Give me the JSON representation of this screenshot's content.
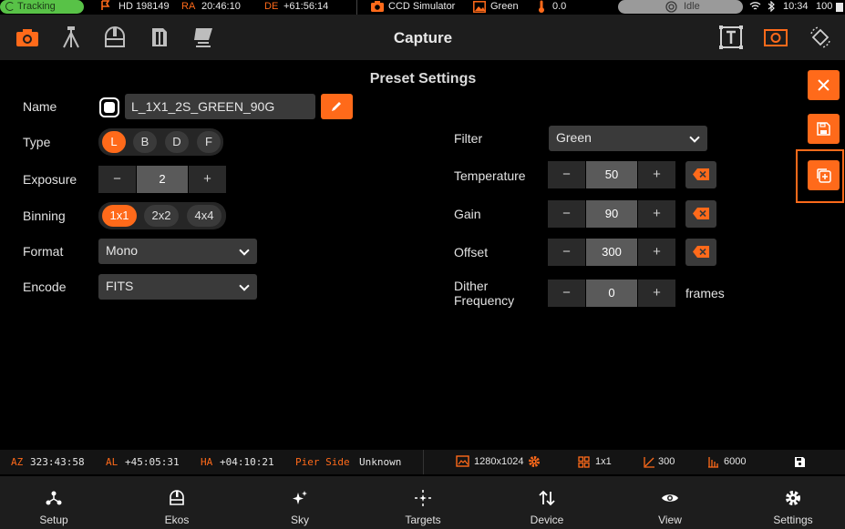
{
  "status_bar": {
    "tracking_label": "Tracking",
    "target": "HD 198149",
    "ra_label": "RA",
    "ra_value": "20:46:10",
    "de_label": "DE",
    "de_value": "+61:56:14",
    "camera": "CCD Simulator",
    "filter": "Green",
    "temperature": "0.0",
    "state": "Idle",
    "time": "10:34",
    "battery": "100"
  },
  "toolbar": {
    "title": "Capture"
  },
  "preset": {
    "section_title": "Preset Settings",
    "name_label": "Name",
    "name_value": "L_1X1_2S_GREEN_90G",
    "type_label": "Type",
    "type_options": [
      "L",
      "B",
      "D",
      "F"
    ],
    "type_selected": "L",
    "exposure_label": "Exposure",
    "exposure_value": "2",
    "binning_label": "Binning",
    "binning_options": [
      "1x1",
      "2x2",
      "4x4"
    ],
    "binning_selected": "1x1",
    "format_label": "Format",
    "format_value": "Mono",
    "encode_label": "Encode",
    "encode_value": "FITS",
    "filter_label": "Filter",
    "filter_value": "Green",
    "temperature_label": "Temperature",
    "temperature_value": "50",
    "gain_label": "Gain",
    "gain_value": "90",
    "offset_label": "Offset",
    "offset_value": "300",
    "dither_label_line1": "Dither",
    "dither_label_line2": "Frequency",
    "dither_value": "0",
    "dither_unit": "frames",
    "minus": "−",
    "plus": "+"
  },
  "info_bar": {
    "az_label": "AZ",
    "az_value": "323:43:58",
    "al_label": "AL",
    "al_value": "+45:05:31",
    "ha_label": "HA",
    "ha_value": "+04:10:21",
    "pier_label": "Pier Side",
    "pier_value": "Unknown",
    "resolution": "1280x1024",
    "binning": "1x1",
    "gain": "300",
    "offset": "6000"
  },
  "bottom_nav": [
    {
      "label": "Setup",
      "icon": "setup-icon"
    },
    {
      "label": "Ekos",
      "icon": "ekos-icon"
    },
    {
      "label": "Sky",
      "icon": "sky-icon"
    },
    {
      "label": "Targets",
      "icon": "targets-icon"
    },
    {
      "label": "Device",
      "icon": "device-icon"
    },
    {
      "label": "View",
      "icon": "view-icon"
    },
    {
      "label": "Settings",
      "icon": "settings-icon"
    }
  ],
  "colors": {
    "accent": "#ff6a1a",
    "tracking": "#58c247",
    "background": "#000000",
    "panel": "#1d1d1d"
  }
}
